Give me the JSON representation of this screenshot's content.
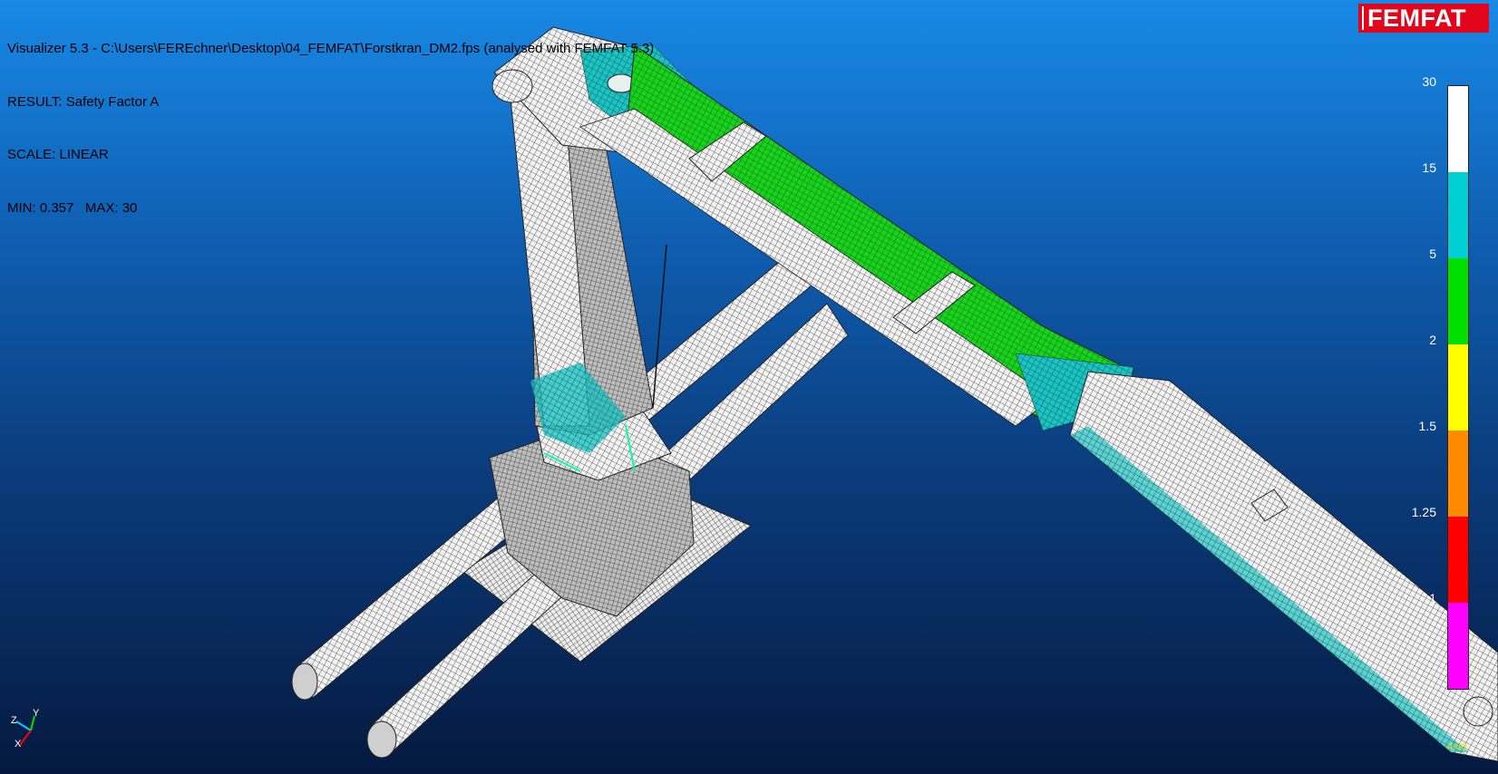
{
  "window_title": "Visualizer 5.3 - C:\\Users\\FEREchner\\Desktop\\04_FEMFAT\\Forstkran_DM2.fps (analysed with FEMFAT 5.3)",
  "result_line": "RESULT: Safety Factor A",
  "scale_line": "SCALE: LINEAR",
  "minmax_line": "MIN: 0.357   MAX: 30",
  "logo_text": "FEMFAT",
  "legend": {
    "ticks": [
      "30",
      "15",
      "5",
      "2",
      "1.5",
      "1.25",
      "1"
    ],
    "band_colors": [
      "#ffffff",
      "#00cfd6",
      "#00e000",
      "#ffff00",
      "#ff8a00",
      "#ff0000",
      "#ff00ff"
    ]
  },
  "triad": {
    "x_label": "X",
    "y_label": "Y",
    "z_label": "Z"
  },
  "status_value": "4.60"
}
